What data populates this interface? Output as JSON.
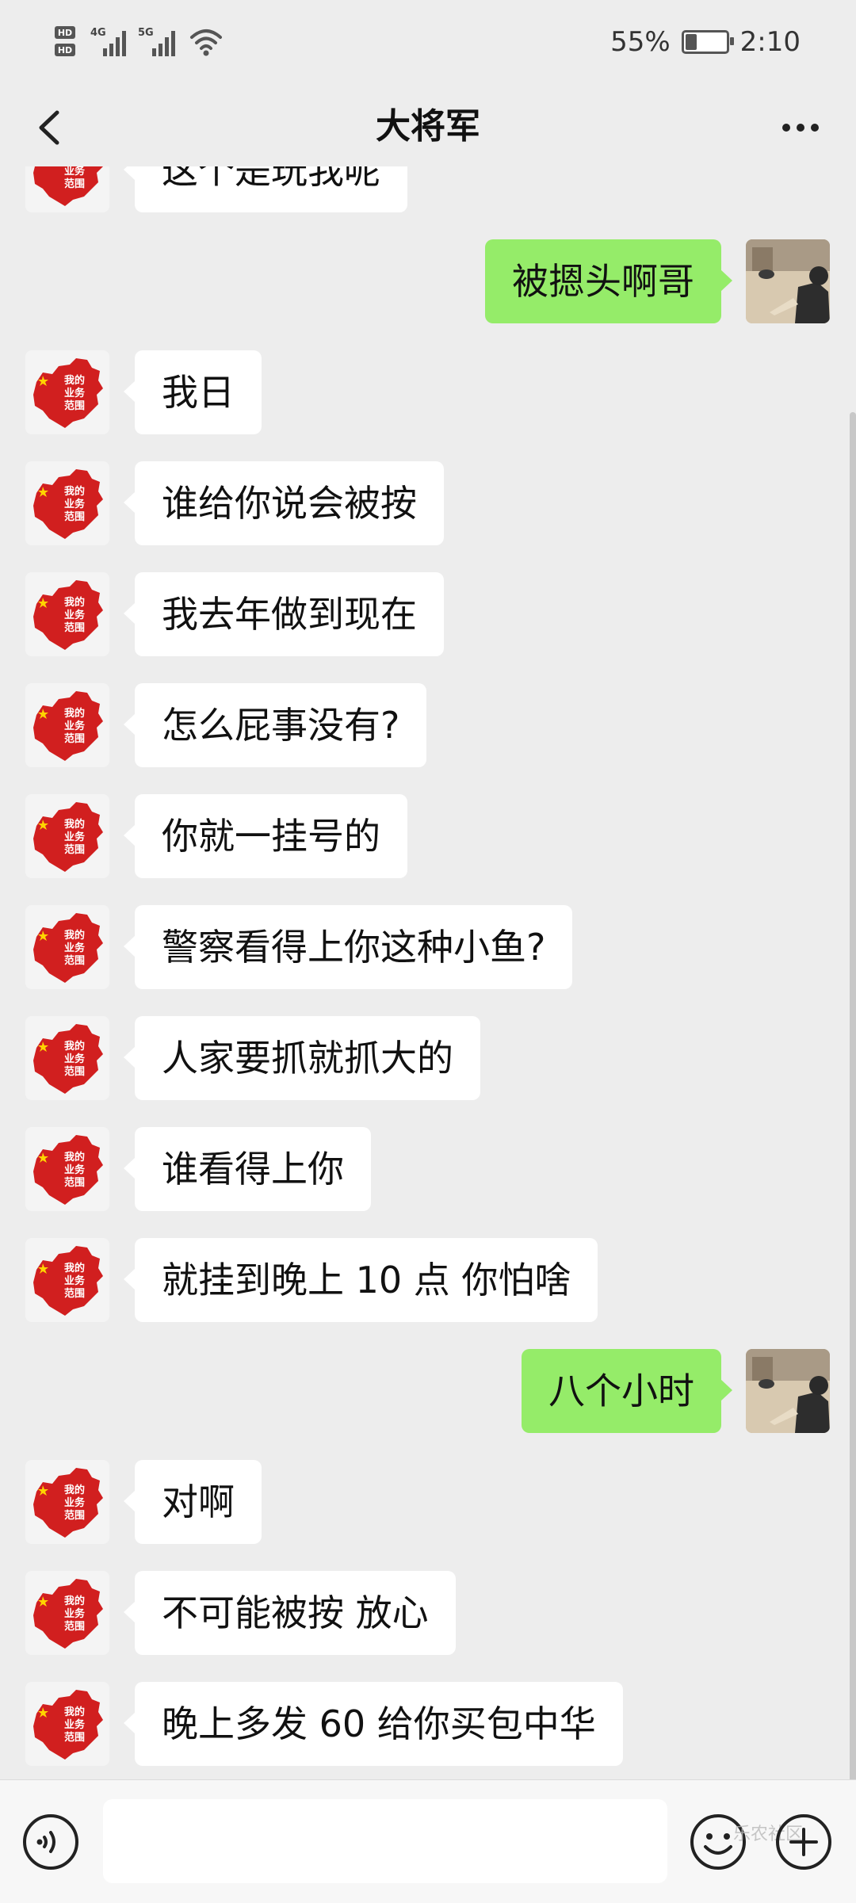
{
  "status_bar": {
    "left_labels": [
      "HD",
      "4G",
      "5G"
    ],
    "battery_percent": "55%",
    "battery_level": 0.55,
    "time": "2:10",
    "icons": [
      "hd-icon",
      "signal-icon",
      "wifi-icon",
      "battery-icon"
    ]
  },
  "header": {
    "title": "大将军",
    "back_icon": "chevron-left-icon",
    "more_icon": "more-dots-icon"
  },
  "messages": [
    {
      "side": "left",
      "text": "这个是玩我呢"
    },
    {
      "side": "right",
      "text": "被摁头啊哥"
    },
    {
      "side": "left",
      "text": "我日"
    },
    {
      "side": "left",
      "text": "谁给你说会被按"
    },
    {
      "side": "left",
      "text": "我去年做到现在"
    },
    {
      "side": "left",
      "text": "怎么屁事没有?"
    },
    {
      "side": "left",
      "text": "你就一挂号的"
    },
    {
      "side": "left",
      "text": "警察看得上你这种小鱼?"
    },
    {
      "side": "left",
      "text": "人家要抓就抓大的"
    },
    {
      "side": "left",
      "text": "谁看得上你"
    },
    {
      "side": "left",
      "text": "就挂到晚上 10 点 你怕啥"
    },
    {
      "side": "right",
      "text": "八个小时"
    },
    {
      "side": "left",
      "text": "对啊"
    },
    {
      "side": "left",
      "text": "不可能被按 放心"
    },
    {
      "side": "left",
      "text": "晚上多发 60 给你买包中华"
    }
  ],
  "avatar_left_text": [
    "我的",
    "业务",
    "范围"
  ],
  "input_bar": {
    "placeholder": "",
    "voice_icon": "voice-icon",
    "emoji_icon": "emoji-icon",
    "plus_icon": "plus-icon",
    "watermark": "乐农社区"
  },
  "colors": {
    "background": "#ededed",
    "bubble_self": "#95ec69",
    "bubble_other": "#ffffff",
    "avatar_map_red": "#d11f1f"
  }
}
